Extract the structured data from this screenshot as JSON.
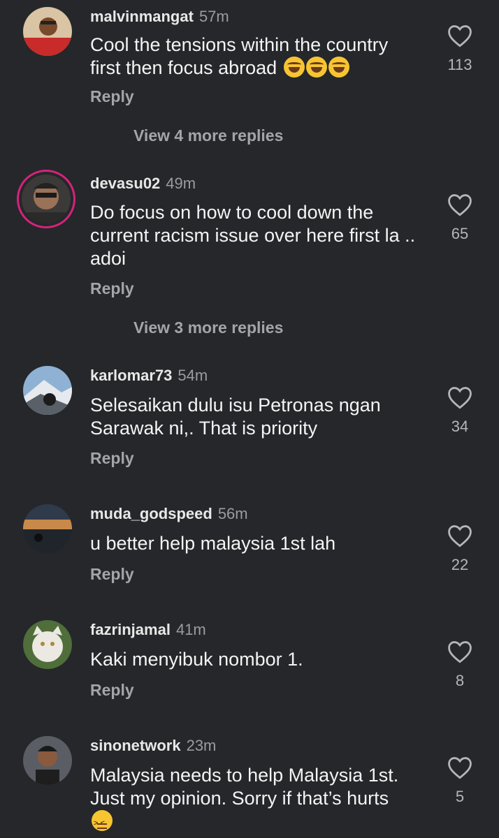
{
  "colors": {
    "background": "#25272a",
    "text": "#f4f4f4",
    "muted": "#a3a5a9",
    "story_ring": "#d6227a"
  },
  "comments": [
    {
      "username": "malvinmangat",
      "time": "57m",
      "text_lines": [
        "Cool the tensions within the country",
        "first then focus abroad"
      ],
      "emojis": [
        "face-with-tears-of-joy-icon",
        "face-with-tears-of-joy-icon",
        "face-with-tears-of-joy-icon"
      ],
      "reply": "Reply",
      "likes": "113",
      "view_more": "View 4 more replies"
    },
    {
      "username": "devasu02",
      "time": "49m",
      "text_lines": [
        "Do focus on how to cool down the",
        "current racism issue over here first la ..",
        "adoi"
      ],
      "reply": "Reply",
      "likes": "65",
      "view_more": "View 3 more replies"
    },
    {
      "username": "karlomar73",
      "time": "54m",
      "text_lines": [
        "Selesaikan dulu isu Petronas ngan",
        "Sarawak ni,. That is priority"
      ],
      "reply": "Reply",
      "likes": "34"
    },
    {
      "username": "muda_godspeed",
      "time": "56m",
      "text_lines": [
        "u better help malaysia 1st lah"
      ],
      "reply": "Reply",
      "likes": "22"
    },
    {
      "username": "fazrinjamal",
      "time": "41m",
      "text_lines": [
        "Kaki menyibuk nombor 1."
      ],
      "reply": "Reply",
      "likes": "8"
    },
    {
      "username": "sinonetwork",
      "time": "23m",
      "text_lines": [
        "Malaysia needs to help Malaysia 1st.",
        "Just my opinion. Sorry if that’s hurts"
      ],
      "emojis": [
        "confounded-face-icon"
      ],
      "likes": "5"
    }
  ]
}
